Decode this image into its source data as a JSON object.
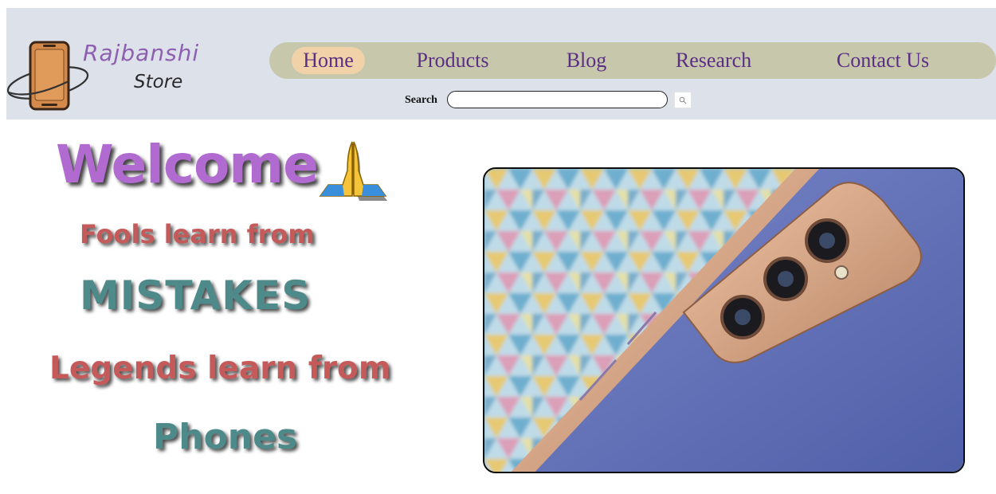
{
  "logo": {
    "line1": "Rajbanshi",
    "line2": "Store",
    "icon": "phone-logo-icon"
  },
  "nav": {
    "items": [
      {
        "label": "Home",
        "active": true
      },
      {
        "label": "Products",
        "active": false
      },
      {
        "label": "Blog",
        "active": false
      },
      {
        "label": "Research",
        "active": false
      },
      {
        "label": "Contact Us",
        "active": false
      }
    ]
  },
  "search": {
    "label": "Search",
    "value": "",
    "icon": "search-icon"
  },
  "hero": {
    "welcome": "Welcome",
    "emoji_icon": "folded-hands-icon",
    "line1": "Fools learn from",
    "line2": "MISTAKES",
    "line3": "Legends learn from",
    "line4": "Phones"
  },
  "photo": {
    "subject": "phone-photo"
  },
  "colors": {
    "header_bg": "#dde1ea",
    "nav_bg": "#c7c8ab",
    "nav_active_bg": "#f0d1a8",
    "nav_text": "#5b2e86",
    "welcome": "#b06ad0",
    "red_text": "#c55a5a",
    "teal_text": "#4f8a8b"
  }
}
